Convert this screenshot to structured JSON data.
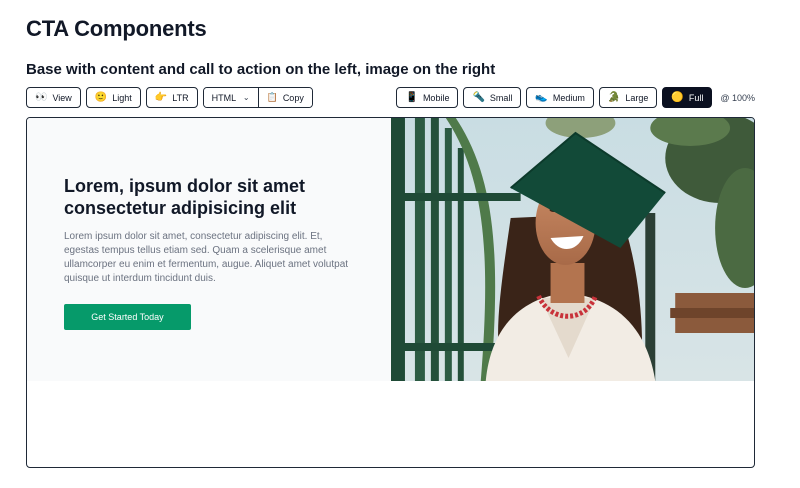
{
  "page": {
    "title": "CTA Components",
    "section_title": "Base with content and call to action on the left, image on the right"
  },
  "toolbar": {
    "left": [
      {
        "icon": "👀",
        "label": "View"
      },
      {
        "icon": "🙂",
        "label": "Light"
      },
      {
        "icon": "👉",
        "label": "LTR"
      }
    ],
    "format_select": {
      "value": "HTML"
    },
    "copy": {
      "icon": "📋",
      "label": "Copy"
    },
    "sizes": [
      {
        "icon": "📱",
        "label": "Mobile"
      },
      {
        "icon": "🔦",
        "label": "Small"
      },
      {
        "icon": "👟",
        "label": "Medium"
      },
      {
        "icon": "🐊",
        "label": "Large"
      },
      {
        "icon": "🟡",
        "label": "Full",
        "active": true
      }
    ],
    "zoom": "@ 100%"
  },
  "cta": {
    "heading": "Lorem, ipsum dolor sit amet consectetur adipisicing elit",
    "body": "Lorem ipsum dolor sit amet, consectetur adipiscing elit. Et, egestas tempus tellus etiam sed. Quam a scelerisque amet ullamcorper eu enim et fermentum, augue. Aliquet amet volutpat quisque ut interdum tincidunt duis.",
    "button": "Get Started Today",
    "button_color": "#069a6a",
    "image": "graduate-photo"
  }
}
